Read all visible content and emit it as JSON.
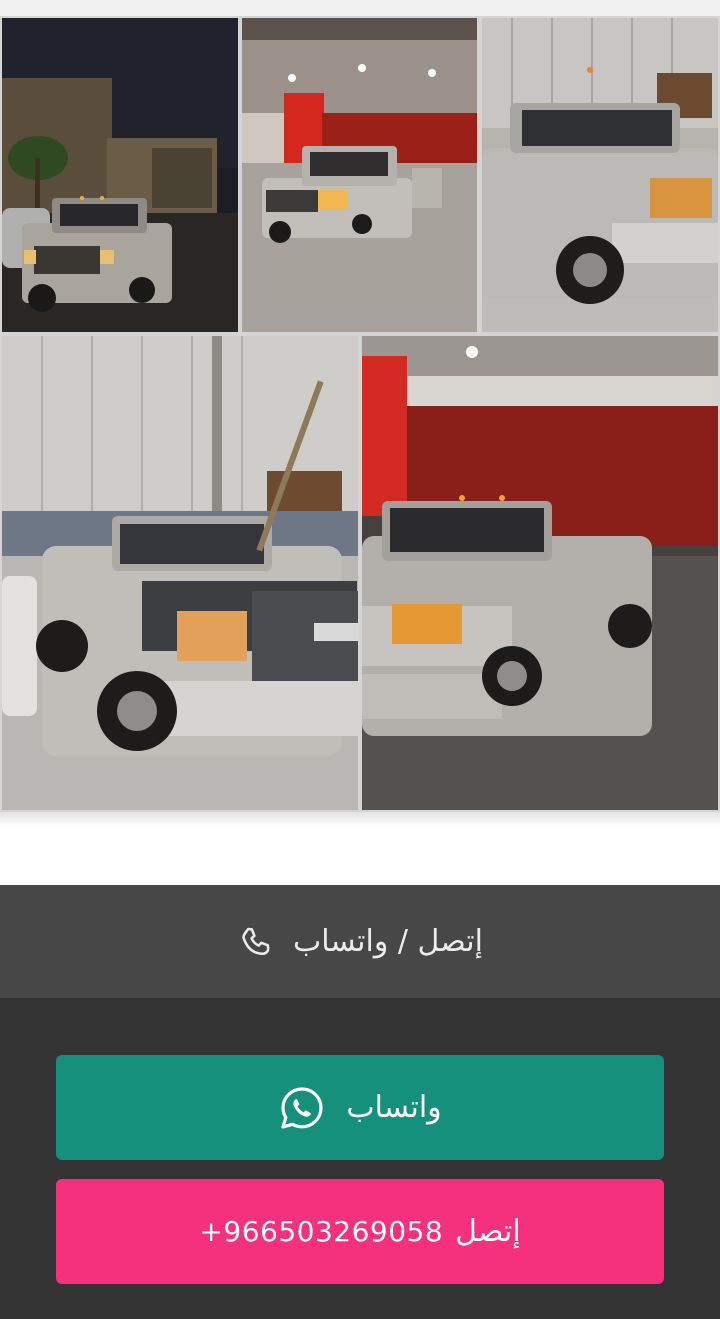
{
  "gallery": {
    "photos": [
      {
        "name": "night-parking-lot-truck"
      },
      {
        "name": "gas-station-truck"
      },
      {
        "name": "workshop-truck-open-hood"
      },
      {
        "name": "workshop-truck-gmc-grille"
      },
      {
        "name": "showroom-truck-lights-on"
      }
    ]
  },
  "contact": {
    "header_label": "إتصل / واتساب",
    "header_icon": "phone-icon",
    "whatsapp_label": "واتساب",
    "whatsapp_icon": "whatsapp-icon",
    "call_label": "إتصل",
    "call_number": "+966503269058"
  },
  "colors": {
    "header_bg": "#474747",
    "body_bg": "#333333",
    "whatsapp": "#14907b",
    "call": "#f5307d"
  }
}
